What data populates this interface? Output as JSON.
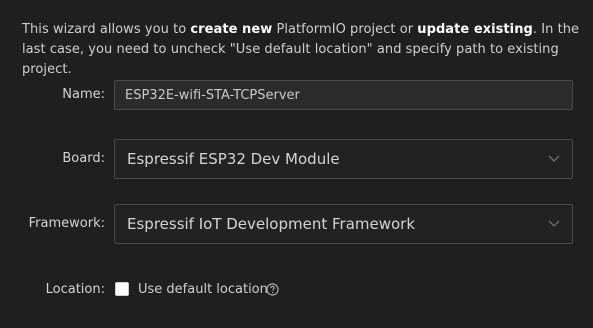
{
  "intro": {
    "part1": "This wizard allows you to ",
    "bold1": "create new",
    "part2": " PlatformIO project or ",
    "bold2": "update existing",
    "part3": ". In the last case, you need to uncheck \"Use default location\" and specify path to existing project."
  },
  "form": {
    "name": {
      "label": "Name",
      "value": "ESP32E-wifi-STA-TCPServer"
    },
    "board": {
      "label": "Board",
      "selected": "Espressif ESP32 Dev Module"
    },
    "framework": {
      "label": "Framework",
      "selected": "Espressif IoT Development Framework"
    },
    "location": {
      "label": "Location",
      "checkbox_label": "Use default location",
      "checked": false
    },
    "label_suffix": ":"
  },
  "icons": {
    "dropdown": "chevron-down-icon",
    "help": "help-circle-icon"
  },
  "colors": {
    "background": "#1f1f1f",
    "input_border": "#4a4a4a",
    "text": "#cccccc"
  }
}
